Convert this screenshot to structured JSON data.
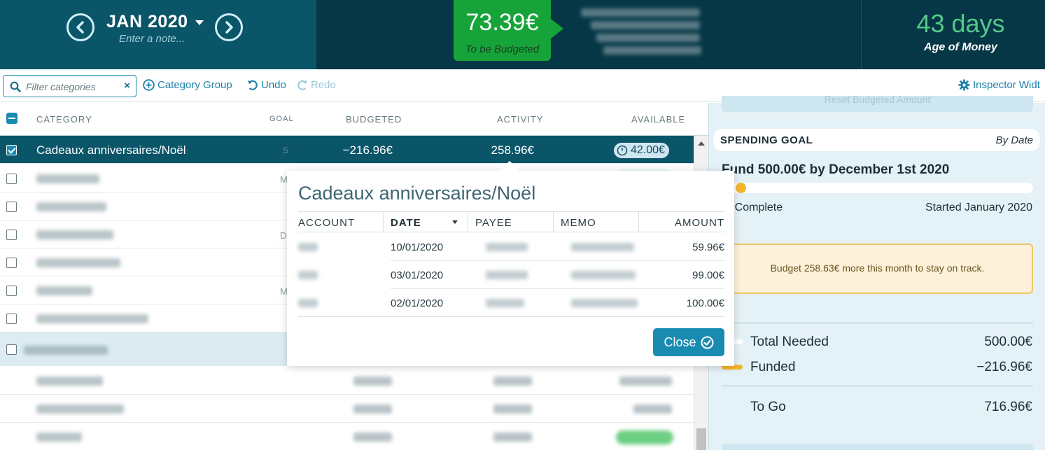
{
  "header": {
    "month": "JAN 2020",
    "note_placeholder": "Enter a note...",
    "to_be_budgeted_amount": "73.39€",
    "to_be_budgeted_label": "To be Budgeted",
    "age_of_money_value": "43 days",
    "age_of_money_label": "Age of Money"
  },
  "toolbar": {
    "filter_placeholder": "Filter categories",
    "filter_clear": "×",
    "category_group_label": "Category Group",
    "undo_label": "Undo",
    "redo_label": "Redo",
    "inspector_width_label": "Inspector Widt"
  },
  "columns": {
    "category": "CATEGORY",
    "goal": "GOAL",
    "budgeted": "BUDGETED",
    "activity": "ACTIVITY",
    "available": "AVAILABLE"
  },
  "selected_row": {
    "name": "Cadeaux anniversaires/Noël",
    "goal": "S",
    "budgeted": "−216.96€",
    "activity": "258.96€",
    "available": "42.00€"
  },
  "row_goal_letters": [
    "M",
    "",
    "D",
    "",
    "M",
    ""
  ],
  "popup": {
    "title": "Cadeaux anniversaires/Noël",
    "columns": [
      "ACCOUNT",
      "DATE",
      "PAYEE",
      "MEMO",
      "AMOUNT"
    ],
    "transactions": [
      {
        "date": "10/01/2020",
        "amount": "59.96€"
      },
      {
        "date": "03/01/2020",
        "amount": "99.00€"
      },
      {
        "date": "02/01/2020",
        "amount": "100.00€"
      }
    ],
    "close_label": "Close"
  },
  "inspector": {
    "reset_label": "Reset Budgeted Amount",
    "goal_title": "SPENDING GOAL",
    "goal_type": "By Date",
    "goal_description": "Fund 500.00€ by December 1st 2020",
    "goal_progress_fraction": 0.0,
    "percent_complete": "% Complete",
    "started": "Started January 2020",
    "track_message": "Budget 258.63€ more this month to stay on track.",
    "total_needed_label": "Total Needed",
    "total_needed_value": "500.00€",
    "funded_label": "Funded",
    "funded_value": "−216.96€",
    "to_go_label": "To Go",
    "to_go_value": "716.96€"
  },
  "colors": {
    "header_bg": "#0b5569",
    "to_be_budgeted_green": "#16a33a",
    "age_of_money_green": "#55c98a",
    "accent_blue": "#1a8bb0",
    "goal_yellow": "#f5b52a"
  },
  "icons": [
    "chevron-left-icon",
    "chevron-right-icon",
    "caret-down-icon",
    "search-icon",
    "plus-circle-icon",
    "undo-icon",
    "redo-icon",
    "gear-icon",
    "clock-icon",
    "check-circle-icon"
  ]
}
